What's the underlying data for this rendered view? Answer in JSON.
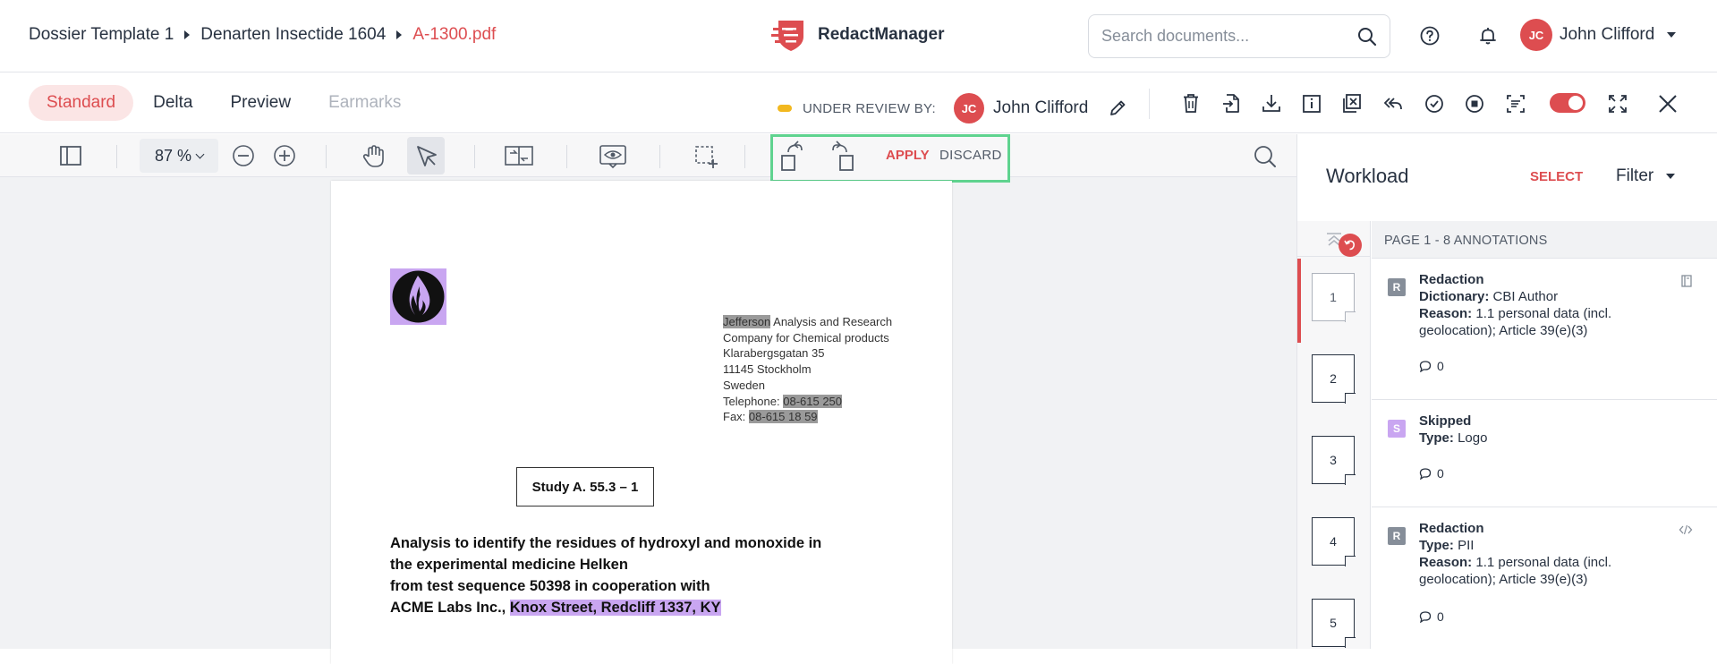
{
  "breadcrumb": {
    "items": [
      "Dossier Template 1",
      "Denarten Insectide 1604",
      "A-1300.pdf"
    ]
  },
  "brand": {
    "name": "RedactManager",
    "color": "#dd4d50"
  },
  "search": {
    "placeholder": "Search documents..."
  },
  "user": {
    "initials": "JC",
    "name": "John Clifford"
  },
  "views": {
    "standard": "Standard",
    "delta": "Delta",
    "preview": "Preview",
    "earmarks": "Earmarks"
  },
  "review": {
    "label": "UNDER REVIEW BY:",
    "initials": "JC",
    "name": "John Clifford",
    "status_color": "#f2b81f"
  },
  "toolbar": {
    "zoom": "87 %",
    "apply": "APPLY",
    "discard": "DISCARD"
  },
  "document": {
    "address_name": "Jefferson",
    "address_rest": " Analysis and Research Company for Chemical products",
    "street": "Klarabergsgatan 35",
    "city": "11145 Stockholm",
    "country": "Sweden",
    "tel_label": "Telephone: ",
    "tel_value": "08-615 250",
    "fax_label": "Fax: ",
    "fax_value": "08-615 18 59",
    "study": "Study A. 55.3 – 1",
    "title_line1": "Analysis to identify the residues of hydroxyl and monoxide in",
    "title_line2": "the experimental medicine Helken",
    "title_line3": "from test sequence 50398 in cooperation with",
    "title_line4_plain": "ACME Labs Inc., ",
    "title_line4_highlight": "Knox Street, Redcliff 1337, KY"
  },
  "workload": {
    "title": "Workload",
    "select": "SELECT",
    "filter": "Filter",
    "list_header": "PAGE 1 - 8 ANNOTATIONS",
    "pages": [
      "1",
      "2",
      "3",
      "4",
      "5"
    ],
    "annotations": [
      {
        "badge": "R",
        "title": "Redaction",
        "line1_label": "Dictionary:",
        "line1_value": " CBI Author",
        "line2_label": "Reason:",
        "line2_value": " 1.1 personal data (incl. geolocation); Article 39(e)(3)",
        "comments": "0"
      },
      {
        "badge": "S",
        "title": "Skipped",
        "line1_label": "Type:",
        "line1_value": " Logo",
        "comments": "0"
      },
      {
        "badge": "R",
        "title": "Redaction",
        "line1_label": "Type:",
        "line1_value": " PII",
        "line2_label": "Reason:",
        "line2_value": " 1.1 personal data (incl. geolocation); Article 39(e)(3)",
        "comments": "0"
      }
    ]
  },
  "colors": {
    "accent": "#dd4d50",
    "highlight_purple": "#c9a6f1",
    "highlight_gray": "#9a9a9a",
    "rotate_box_border": "#5fd38f"
  }
}
